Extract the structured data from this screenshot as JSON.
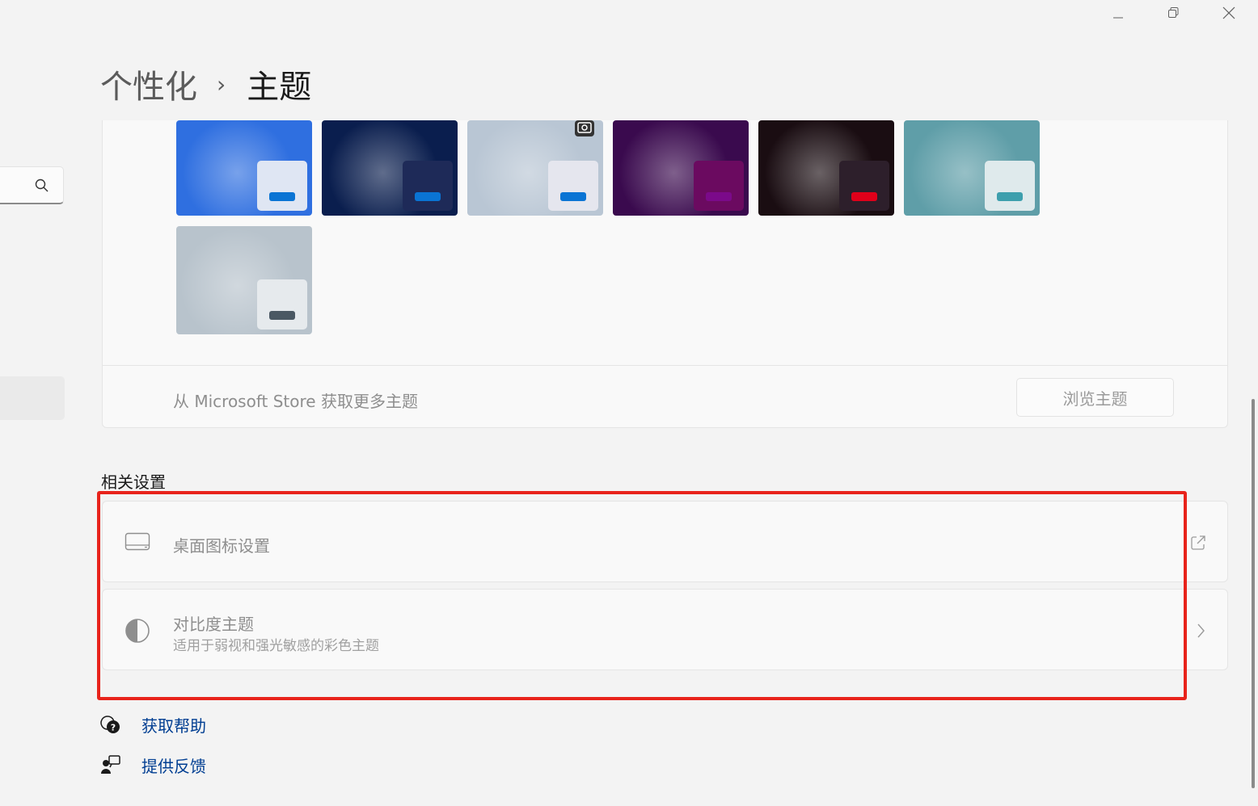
{
  "window": {
    "minimize_icon": "minimize-icon",
    "restore_icon": "restore-icon",
    "close_icon": "close-icon"
  },
  "sidebar": {
    "search_icon": "search-icon"
  },
  "breadcrumb": {
    "parent": "个性化",
    "separator": "›",
    "current": "主题"
  },
  "themes": [
    {
      "name": "windows-light",
      "bg": "#2f6fe0",
      "tile": "#dfe6f3",
      "accent": "#0a74d4",
      "camera": false
    },
    {
      "name": "windows-dark",
      "bg": "#0a1e4e",
      "tile": "#1e2a58",
      "accent": "#0a74d4",
      "camera": false
    },
    {
      "name": "captured-motion",
      "bg": "#b9c6d4",
      "tile": "#e5e6ee",
      "accent": "#0a74d4",
      "camera": true
    },
    {
      "name": "glow",
      "bg": "#3a0a4e",
      "tile": "#6b0a60",
      "accent": "#7b0a8a",
      "camera": false
    },
    {
      "name": "flow",
      "bg": "#1a0d12",
      "tile": "#2d1f2b",
      "accent": "#e0001a",
      "camera": false
    },
    {
      "name": "sunrise",
      "bg": "#5f9ea8",
      "tile": "#dfeaec",
      "accent": "#3d9fad",
      "camera": false
    },
    {
      "name": "bloom-light",
      "bg": "#b8c3cc",
      "tile": "#e6eaed",
      "accent": "#4a5863",
      "camera": false
    }
  ],
  "store": {
    "text": "从 Microsoft Store 获取更多主题",
    "button": "浏览主题"
  },
  "related": {
    "title": "相关设置",
    "desktop_icons": {
      "label": "桌面图标设置",
      "icon": "desktop-icon",
      "right_icon": "open-external-icon"
    },
    "contrast": {
      "label": "对比度主题",
      "sub": "适用于弱视和强光敏感的彩色主题",
      "icon": "contrast-icon",
      "right_icon": "chevron-right-icon"
    }
  },
  "footer": {
    "help": "获取帮助",
    "feedback": "提供反馈"
  },
  "colors": {
    "accent": "#003e92",
    "highlight": "#e8231b"
  }
}
